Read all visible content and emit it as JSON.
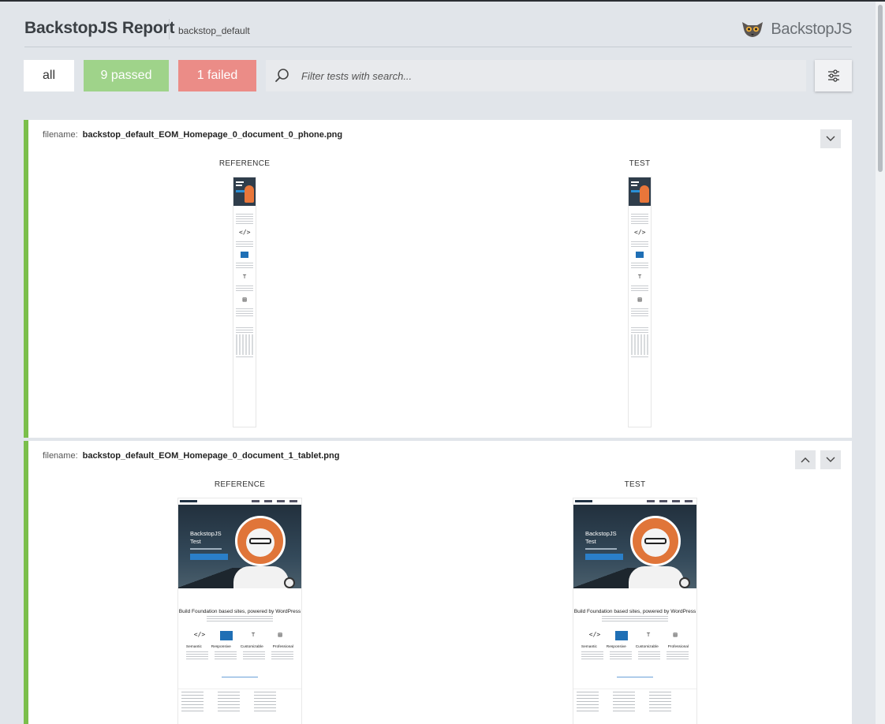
{
  "header": {
    "title": "BackstopJS Report",
    "suite": "backstop_default",
    "brand": "BackstopJS",
    "brand_icon": "lemur-logo-icon"
  },
  "toolbar": {
    "all_label": "all",
    "passed_label": "9 passed",
    "failed_label": "1 failed",
    "search_placeholder": "Filter tests with search...",
    "search_icon": "search-icon",
    "settings_icon": "sliders-icon"
  },
  "colors": {
    "passed": "#9fd38a",
    "failed": "#eb8c87",
    "pass_stripe": "#7bbf4b",
    "background": "#e1e5ea"
  },
  "tests": [
    {
      "filename_label": "filename:",
      "filename": "backstop_default_EOM_Homepage_0_document_0_phone.png",
      "reference_label": "REFERENCE",
      "test_label": "TEST"
    },
    {
      "filename_label": "filename:",
      "filename": "backstop_default_EOM_Homepage_0_document_1_tablet.png",
      "reference_label": "REFERENCE",
      "test_label": "TEST",
      "shot": {
        "hero_title_1": "BackstopJS",
        "hero_title_2": "Test",
        "heading": "Build Foundation based sites, powered by WordPress",
        "features": [
          "Semantic",
          "Responsive",
          "Customizable",
          "Professional"
        ]
      }
    }
  ]
}
